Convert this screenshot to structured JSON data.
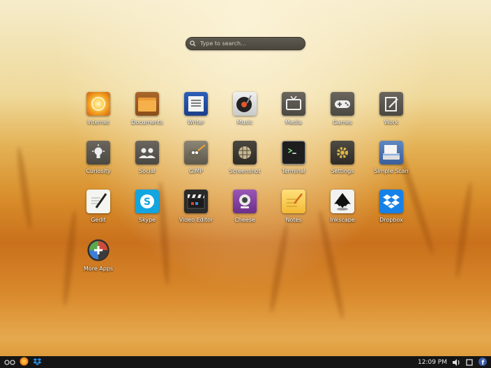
{
  "search": {
    "placeholder": "Type to search..."
  },
  "apps": [
    {
      "label": "Internet",
      "icon": "internet-icon"
    },
    {
      "label": "Documents",
      "icon": "folder-icon"
    },
    {
      "label": "Writer",
      "icon": "writer-icon"
    },
    {
      "label": "Music",
      "icon": "music-icon"
    },
    {
      "label": "Media",
      "icon": "tv-icon"
    },
    {
      "label": "Games",
      "icon": "gamepad-icon"
    },
    {
      "label": "Work",
      "icon": "work-icon"
    },
    {
      "label": "Curiosity",
      "icon": "lightbulb-icon"
    },
    {
      "label": "Social",
      "icon": "people-icon"
    },
    {
      "label": "GIMP",
      "icon": "gimp-icon"
    },
    {
      "label": "Screenshot",
      "icon": "screenshot-icon"
    },
    {
      "label": "Terminal",
      "icon": "terminal-icon"
    },
    {
      "label": "Settings",
      "icon": "gear-icon"
    },
    {
      "label": "Simple Scan",
      "icon": "scanner-icon"
    },
    {
      "label": "Gedit",
      "icon": "gedit-icon"
    },
    {
      "label": "Skype",
      "icon": "skype-icon"
    },
    {
      "label": "Video Editor",
      "icon": "clapperboard-icon"
    },
    {
      "label": "Cheese",
      "icon": "webcam-icon"
    },
    {
      "label": "Notes",
      "icon": "notes-icon"
    },
    {
      "label": "Inkscape",
      "icon": "inkscape-icon"
    },
    {
      "label": "Dropbox",
      "icon": "dropbox-icon"
    },
    {
      "label": "More Apps",
      "icon": "software-center-icon"
    }
  ],
  "taskbar": {
    "clock": "12:09 PM",
    "left_icons": [
      "apps-menu-icon",
      "firefox-icon",
      "dropbox-tray-icon"
    ],
    "right_icons": [
      "volume-icon",
      "window-icon",
      "facebook-icon"
    ]
  },
  "colors": {
    "taskbar": "#151515",
    "search_bg": "#544f46",
    "dropbox_blue": "#1681e6",
    "skype_blue": "#12a5e0"
  }
}
